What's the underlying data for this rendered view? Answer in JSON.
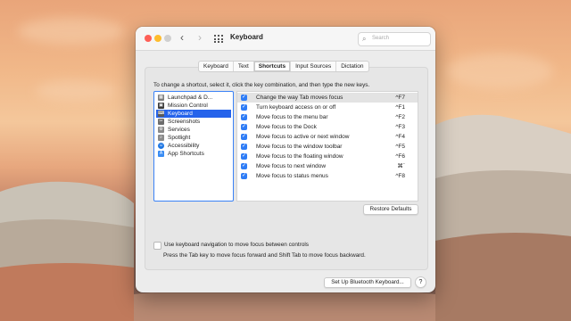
{
  "window": {
    "title": "Keyboard"
  },
  "search": {
    "placeholder": "Search"
  },
  "tabs": [
    {
      "label": "Keyboard",
      "active": false
    },
    {
      "label": "Text",
      "active": false
    },
    {
      "label": "Shortcuts",
      "active": true
    },
    {
      "label": "Input Sources",
      "active": false
    },
    {
      "label": "Dictation",
      "active": false
    }
  ],
  "instructions": "To change a shortcut, select it, click the key combination, and then type the new keys.",
  "categories": [
    {
      "label": "Launchpad & D...",
      "icon": "launchpad-icon",
      "color": "#7d7d7d",
      "selected": false
    },
    {
      "label": "Mission Control",
      "icon": "mission-control-icon",
      "color": "#3a3a3a",
      "selected": false
    },
    {
      "label": "Keyboard",
      "icon": "keyboard-icon",
      "color": "#5a5a5a",
      "selected": true
    },
    {
      "label": "Screenshots",
      "icon": "screenshot-icon",
      "color": "#6d6d6d",
      "selected": false
    },
    {
      "label": "Services",
      "icon": "gear-icon",
      "color": "#8a8a8a",
      "selected": false
    },
    {
      "label": "Spotlight",
      "icon": "spotlight-icon",
      "color": "#8a8a8a",
      "selected": false
    },
    {
      "label": "Accessibility",
      "icon": "accessibility-icon",
      "color": "#1e76e3",
      "selected": false
    },
    {
      "label": "App Shortcuts",
      "icon": "app-shortcuts-icon",
      "color": "#3a8cf3",
      "selected": false
    }
  ],
  "shortcuts": [
    {
      "label": "Change the way Tab moves focus",
      "key": "^F7",
      "checked": true,
      "highlighted": true
    },
    {
      "label": "Turn keyboard access on or off",
      "key": "^F1",
      "checked": true,
      "highlighted": false
    },
    {
      "label": "Move focus to the menu bar",
      "key": "^F2",
      "checked": true,
      "highlighted": false
    },
    {
      "label": "Move focus to the Dock",
      "key": "^F3",
      "checked": true,
      "highlighted": false
    },
    {
      "label": "Move focus to active or next window",
      "key": "^F4",
      "checked": true,
      "highlighted": false
    },
    {
      "label": "Move focus to the window toolbar",
      "key": "^F5",
      "checked": true,
      "highlighted": false
    },
    {
      "label": "Move focus to the floating window",
      "key": "^F6",
      "checked": true,
      "highlighted": false
    },
    {
      "label": "Move focus to next window",
      "key": "⌘`",
      "checked": true,
      "highlighted": false
    },
    {
      "label": "Move focus to status menus",
      "key": "^F8",
      "checked": true,
      "highlighted": false
    }
  ],
  "buttons": {
    "restore": "Restore Defaults",
    "bluetooth": "Set Up Bluetooth Keyboard...",
    "help": "?"
  },
  "keyboard_nav": {
    "label": "Use keyboard navigation to move focus between controls",
    "checked": false,
    "note": "Press the Tab key to move focus forward and Shift Tab to move focus backward."
  },
  "colors": {
    "accent": "#2563eb",
    "checkbox": "#2e7cf6"
  }
}
